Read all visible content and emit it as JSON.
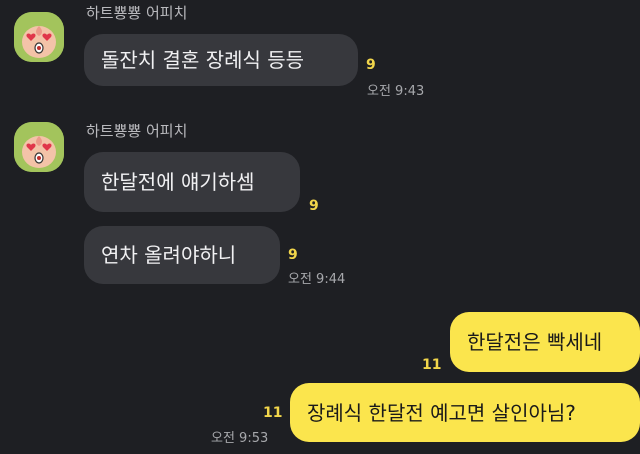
{
  "chat": {
    "groups": [
      {
        "sender": "하트뿅뿅 어피치",
        "messages": [
          {
            "text": "돌잔치 결혼 장례식 등등",
            "unread": "9",
            "time": "오전 9:43"
          }
        ]
      },
      {
        "sender": "하트뿅뿅 어피치",
        "messages": [
          {
            "text": "한달전에 얘기하셈",
            "unread": "9"
          },
          {
            "text": "연차 올려야하니",
            "unread": "9",
            "time": "오전 9:44"
          }
        ]
      }
    ],
    "outgoing": [
      {
        "text": "한달전은 빡세네",
        "unread": "11"
      },
      {
        "text": "장례식 한달전 예고면 살인아님?",
        "unread": "11",
        "time": "오전 9:53"
      }
    ]
  },
  "colors": {
    "background": "#1e1f23",
    "incoming_bubble": "#37383d",
    "outgoing_bubble": "#fbe54d",
    "unread_count": "#f2d64b",
    "avatar_bg": "#a3c45c"
  },
  "icons": {
    "avatar": "apeach-heart-eyes-icon"
  }
}
